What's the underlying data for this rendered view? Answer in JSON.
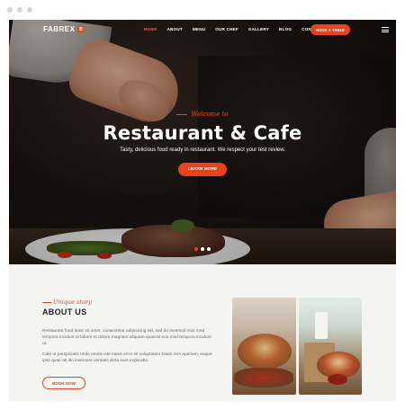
{
  "window": {
    "controls": [
      "dot",
      "dot",
      "dot"
    ]
  },
  "nav": {
    "logo_text": "FABREX",
    "logo_badge": "B",
    "items": [
      {
        "label": "HOME",
        "active": true
      },
      {
        "label": "ABOUT",
        "active": false
      },
      {
        "label": "MENU",
        "active": false
      },
      {
        "label": "OUR CHEF",
        "active": false
      },
      {
        "label": "GALLERY",
        "active": false
      },
      {
        "label": "BLOG",
        "active": false
      },
      {
        "label": "CONTACT",
        "active": false
      }
    ],
    "book_button": "BOOK A TABLE",
    "menu_icon": "hamburger-icon"
  },
  "hero": {
    "welcome": "Welcome to",
    "title": "Restaurant & Cafe",
    "subtitle": "Tasty, delicious food ready in restaurant. We respect your test review.",
    "button": "LEARN MORE",
    "slider_dots": 3,
    "active_dot": 0
  },
  "about": {
    "kicker": "Unique story",
    "title": "ABOUT US",
    "p1": "Restaurant food dolor sit amet, consectetur adipisicing elit, sed do eiusmod eius mod tempora incidunt ut labore et dolore magnam aliquam quaerat eus mod tempora incidunt ut.",
    "p2": "Cafe ut perspiciatis unde omnis iste natus error sit voluptatem totam rem aperiam, eaque ipsa quae ab illo inventore veritatis dicta sunt explicabo.",
    "button": "BOOK NOW"
  },
  "colors": {
    "accent": "#e8421a",
    "dark": "#1c1614",
    "text": "#222222",
    "muted": "#666666",
    "bg": "#f4f4f2"
  }
}
